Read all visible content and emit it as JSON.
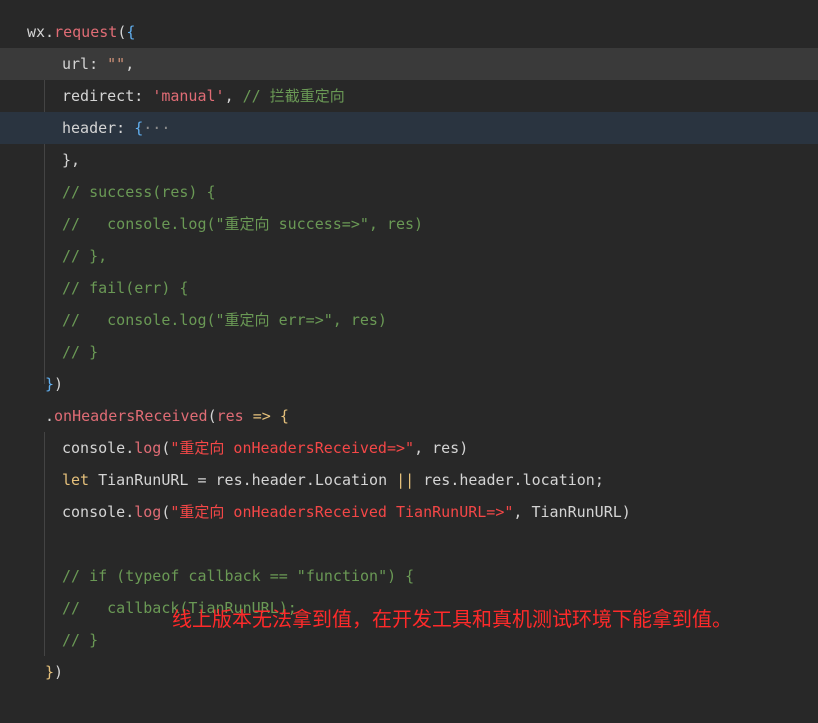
{
  "code": {
    "lines": [
      {
        "id": "l1",
        "parts": [
          {
            "t": "wx.",
            "c": "punc"
          },
          {
            "t": "request",
            "c": "fn"
          },
          {
            "t": "(",
            "c": "punc"
          },
          {
            "t": "{",
            "c": "brace-b"
          }
        ]
      },
      {
        "id": "l2",
        "parts": [
          {
            "t": "url: ",
            "c": "punc"
          },
          {
            "t": "\"\"",
            "c": "str"
          },
          {
            "t": ",",
            "c": "punc"
          }
        ]
      },
      {
        "id": "l3",
        "parts": [
          {
            "t": "redirect: ",
            "c": "punc"
          },
          {
            "t": "'manual'",
            "c": "fn"
          },
          {
            "t": ", ",
            "c": "punc"
          },
          {
            "t": "// 拦截重定向",
            "c": "comment"
          }
        ]
      },
      {
        "id": "l4",
        "parts": [
          {
            "t": "header: ",
            "c": "punc"
          },
          {
            "t": "{",
            "c": "brace-b"
          },
          {
            "t": "···",
            "c": "fold"
          }
        ]
      },
      {
        "id": "l5",
        "parts": [
          {
            "t": "},",
            "c": "punc"
          }
        ]
      },
      {
        "id": "l6",
        "parts": [
          {
            "t": "// success(res) {",
            "c": "comment"
          }
        ]
      },
      {
        "id": "l7",
        "parts": [
          {
            "t": "//   console.log(\"重定向 success=>\", res)",
            "c": "comment"
          }
        ]
      },
      {
        "id": "l8",
        "parts": [
          {
            "t": "// },",
            "c": "comment"
          }
        ]
      },
      {
        "id": "l9",
        "parts": [
          {
            "t": "// fail(err) {",
            "c": "comment"
          }
        ]
      },
      {
        "id": "l10",
        "parts": [
          {
            "t": "//   console.log(\"重定向 err=>\", res)",
            "c": "comment"
          }
        ]
      },
      {
        "id": "l11",
        "parts": [
          {
            "t": "// }",
            "c": "comment"
          }
        ]
      },
      {
        "id": "l12",
        "parts": [
          {
            "t": "}",
            "c": "brace-b"
          },
          {
            "t": ")",
            "c": "punc"
          }
        ]
      },
      {
        "id": "l13",
        "parts": [
          {
            "t": ".",
            "c": "punc"
          },
          {
            "t": "onHeadersReceived",
            "c": "fn"
          },
          {
            "t": "(",
            "c": "punc"
          },
          {
            "t": "res",
            "c": "fn"
          },
          {
            "t": " => ",
            "c": "kw"
          },
          {
            "t": "{",
            "c": "brace-y"
          }
        ]
      },
      {
        "id": "l14",
        "parts": [
          {
            "t": "console.",
            "c": "punc"
          },
          {
            "t": "log",
            "c": "fn"
          },
          {
            "t": "(",
            "c": "punc"
          },
          {
            "t": "\"重定向 onHeadersReceived=>\"",
            "c": "str-red"
          },
          {
            "t": ", res)",
            "c": "punc"
          }
        ]
      },
      {
        "id": "l15",
        "parts": [
          {
            "t": "let",
            "c": "kw"
          },
          {
            "t": " TianRunURL = res.header.Location ",
            "c": "punc"
          },
          {
            "t": "||",
            "c": "kw"
          },
          {
            "t": " res.header.location;",
            "c": "punc"
          }
        ]
      },
      {
        "id": "l16",
        "parts": [
          {
            "t": "console.",
            "c": "punc"
          },
          {
            "t": "log",
            "c": "fn"
          },
          {
            "t": "(",
            "c": "punc"
          },
          {
            "t": "\"重定向 onHeadersReceived TianRunURL=>\"",
            "c": "str-red"
          },
          {
            "t": ", TianRunURL)",
            "c": "punc"
          }
        ]
      },
      {
        "id": "l17",
        "parts": []
      },
      {
        "id": "l18",
        "parts": [
          {
            "t": "// if (typeof callback == \"function\") {",
            "c": "comment"
          }
        ]
      },
      {
        "id": "l19",
        "parts": [
          {
            "t": "//   callback(TianRunURL);",
            "c": "comment"
          }
        ]
      },
      {
        "id": "l20",
        "parts": [
          {
            "t": "// }",
            "c": "comment"
          }
        ]
      },
      {
        "id": "l21",
        "parts": [
          {
            "t": "}",
            "c": "brace-y"
          },
          {
            "t": ")",
            "c": "punc"
          }
        ]
      }
    ]
  },
  "annotation": {
    "text": "线上版本无法拿到值，在开发工具和真机测试环境下能拿到值。"
  }
}
